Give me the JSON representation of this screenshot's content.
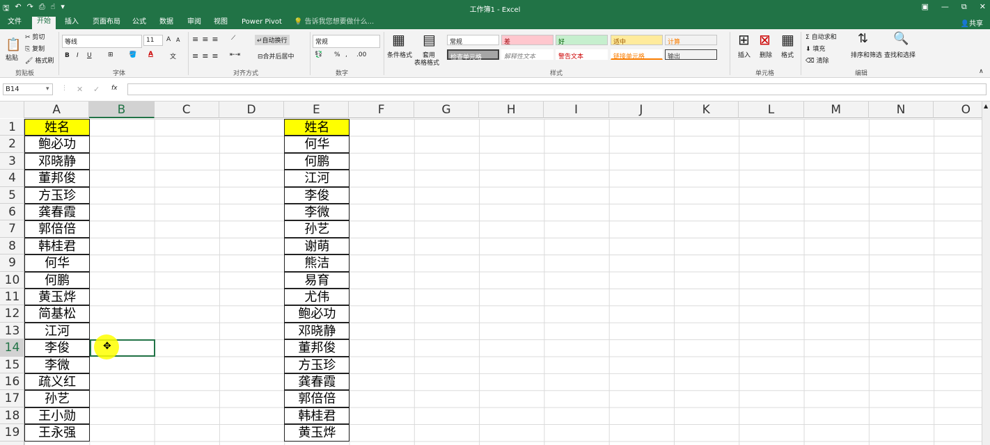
{
  "window": {
    "title": "工作簿1 - Excel",
    "share": "共享",
    "controls": [
      "▣",
      "—",
      "⧉",
      "✕"
    ]
  },
  "ribbon_tabs": [
    "文件",
    "开始",
    "插入",
    "页面布局",
    "公式",
    "数据",
    "审阅",
    "视图",
    "Power Pivot"
  ],
  "tell_me": "告诉我您想要做什么...",
  "clipboard": {
    "paste": "粘贴",
    "cut": "剪切",
    "copy": "复制",
    "painter": "格式刷",
    "label": "剪贴板"
  },
  "font": {
    "name": "等线",
    "size": "11",
    "label": "字体",
    "grow": "A",
    "shrink": "A",
    "bold": "B",
    "italic": "I",
    "underline": "U"
  },
  "alignment": {
    "wrap": "自动换行",
    "merge": "合并后居中",
    "label": "对齐方式"
  },
  "number": {
    "format": "常规",
    "label": "数字",
    "percent": "%"
  },
  "styles": {
    "cond": "条件格式",
    "table1": "套用",
    "table2": "表格格式",
    "label": "样式",
    "cells": [
      "常规",
      "差",
      "好",
      "适中",
      "计算",
      "检查单元格",
      "解释性文本",
      "警告文本",
      "链接单元格",
      "输出"
    ]
  },
  "cells_group": {
    "insert": "插入",
    "delete": "删除",
    "format": "格式",
    "label": "单元格"
  },
  "editing": {
    "autosum": "自动求和",
    "fill": "填充",
    "clear": "清除",
    "sort": "排序和筛选",
    "find": "查找和选择",
    "label": "编辑"
  },
  "formula_bar": {
    "namebox": "B14",
    "fx": "fx",
    "value": ""
  },
  "columns": [
    "A",
    "B",
    "C",
    "D",
    "E",
    "F",
    "G",
    "H",
    "I",
    "J",
    "K",
    "L",
    "M",
    "N",
    "O"
  ],
  "selected_column": "B",
  "rows": [
    "1",
    "2",
    "3",
    "4",
    "5",
    "6",
    "7",
    "8",
    "9",
    "10",
    "11",
    "12",
    "13",
    "14",
    "15",
    "16",
    "17",
    "18",
    "19"
  ],
  "selected_row": "14",
  "col_a": [
    "姓名",
    "鲍必功",
    "邓晓静",
    "董邦俊",
    "方玉珍",
    "龚春霞",
    "郭倍倍",
    "韩桂君",
    "何华",
    "何鹏",
    "黄玉烨",
    "简基松",
    "江河",
    "李俊",
    "李微",
    "疏义红",
    "孙艺",
    "王小勋",
    "王永强"
  ],
  "col_e": [
    "姓名",
    "何华",
    "何鹏",
    "江河",
    "李俊",
    "李微",
    "孙艺",
    "谢萌",
    "熊洁",
    "易育",
    "尤伟",
    "鲍必功",
    "邓晓静",
    "董邦俊",
    "方玉珍",
    "龚春霞",
    "郭倍倍",
    "韩桂君",
    "黄玉烨"
  ],
  "cursor_glyph": "✥"
}
